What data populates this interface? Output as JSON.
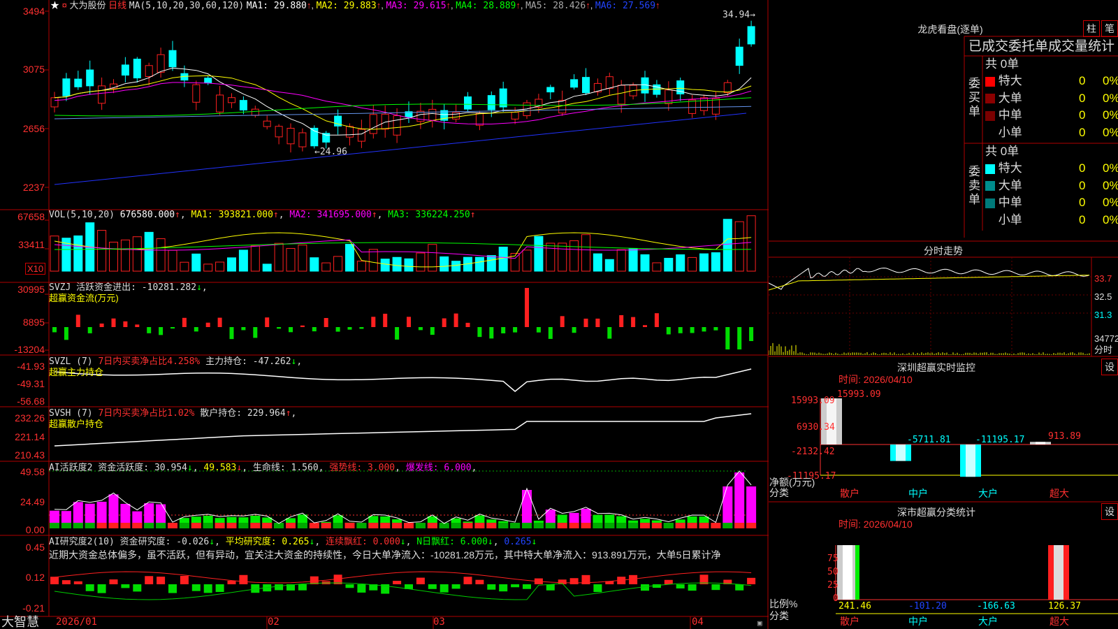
{
  "colors": {
    "up": "#ff2020",
    "down": "#00ffff",
    "ma1": "#ffffff",
    "ma2": "#ffff00",
    "ma3": "#ff00ff",
    "ma4": "#00ff00",
    "ma5": "#6495ed",
    "ma6": "#2222ff",
    "grid": "#aa0000",
    "yellow": "#ffff00",
    "green": "#00ff00",
    "magenta": "#ff00ff"
  },
  "brand": "大智慧",
  "k": {
    "header_prefix": "大为股份",
    "period": "日线",
    "ma_params": "MA(5,10,20,30,60,120)",
    "ma_labels": [
      "MA1: 29.880",
      "MA2: 29.883",
      "MA3: 29.615",
      "MA4: 28.889",
      "MA5: 28.426",
      "MA6: 27.569"
    ],
    "y_labels": [
      "3494",
      "3075",
      "2656",
      "2237"
    ],
    "high_label": "34.94",
    "low_label": "24.96"
  },
  "vol": {
    "header": "VOL(5,10,20)",
    "value": "676580.000",
    "ma_labels": [
      "MA1: 393821.000",
      "MA2: 341695.000",
      "MA3: 336224.250"
    ],
    "y_labels": [
      "67658",
      "33411"
    ],
    "unit": "X10"
  },
  "svzj": {
    "header": "SVZJ  活跃资金进出: -10281.282",
    "subtitle": "超赢资金流(万元)",
    "y_labels": [
      "30995",
      "8895",
      "-13204"
    ]
  },
  "svzl": {
    "header": "SVZL (7)",
    "pct": "7日内买卖净占比4.258%",
    "hold": "主力持仓: -47.262",
    "subtitle": "超赢主力持仓",
    "y_labels": [
      "-41.93",
      "-49.31",
      "-56.68"
    ]
  },
  "svsh": {
    "header": "SVSH (7)",
    "pct": "7日内买卖净占比1.02%",
    "hold": "散户持仓: 229.964",
    "subtitle": "超赢散户持仓",
    "y_labels": [
      "232.26",
      "221.14",
      "210.43"
    ]
  },
  "aihy": {
    "header": "AI活跃度2 资金活跃度: 30.954",
    "v2": "49.583",
    "v3": "生命线: 1.560",
    "v4": "强势线: 3.000",
    "v5": "爆发线: 6.000",
    "y_labels": [
      "49.58",
      "24.49",
      "0.00"
    ]
  },
  "aiyj": {
    "header": "AI研究度2(10) 资金研究度: -0.026",
    "v2": "平均研究度: 0.265",
    "v3": "连续飘红: 0.000",
    "v4": "N日飘红: 6.000",
    "v5": "0.265",
    "comment": "近期大资金总体偏多，虽不活跃，但有异动，宜关注大资金的持续性，今日大单净流入：-10281.28万元，其中特大单净流入：913.891万元，大单5日累计净",
    "y_labels": [
      "0.45",
      "0.12",
      "-0.21"
    ]
  },
  "x_labels": [
    "2026/01",
    "02",
    "03",
    "04"
  ],
  "lhb": {
    "title": "龙虎看盘(逐单)",
    "btn1": "柱",
    "btn2": "笔",
    "tabs": "已成交委托单成交量统计",
    "buy_label": "委买单",
    "sell_label": "委卖单",
    "buy_total": "共 0单",
    "sell_total": "共 0单",
    "buy_rows": [
      {
        "name": "特大",
        "n": "0",
        "pct": "0%",
        "color": "#ff0000"
      },
      {
        "name": "大单",
        "n": "0",
        "pct": "0%",
        "color": "#8b0000"
      },
      {
        "name": "中单",
        "n": "0",
        "pct": "0%",
        "color": "#7a0000"
      },
      {
        "name": "小单",
        "n": "0",
        "pct": "0%",
        "color": "#000000"
      }
    ],
    "sell_rows": [
      {
        "name": "特大",
        "n": "0",
        "pct": "0%",
        "color": "#00ffff"
      },
      {
        "name": "大单",
        "n": "0",
        "pct": "0%",
        "color": "#008b8b"
      },
      {
        "name": "中单",
        "n": "0",
        "pct": "0%",
        "color": "#007a7a"
      },
      {
        "name": "小单",
        "n": "0",
        "pct": "0%",
        "color": "#000000"
      }
    ]
  },
  "fs": {
    "title": "分时走势",
    "y_labels": [
      "33.7",
      "32.5",
      "31.3"
    ],
    "vol_label": "34772",
    "x_label": "分时"
  },
  "szcy": {
    "title": "深圳超赢实时监控",
    "btn": "设",
    "time": "时间: 2026/04/10",
    "y_labels": [
      "15993.09",
      "6930.34",
      "-2132.42",
      "-11195.17"
    ],
    "y_unit": "净额(万元)",
    "x_unit": "分类",
    "cats": [
      "散户",
      "中户",
      "大户",
      "超大"
    ],
    "values": [
      15993.09,
      -5711.81,
      -11195.17,
      913.89
    ],
    "value_labels": [
      "15993.09",
      "-5711.81",
      "-11195.17",
      "913.89"
    ]
  },
  "scfl": {
    "title": "深市超赢分类统计",
    "btn": "设",
    "time": "时间: 2026/04/10",
    "y_labels": [
      "75",
      "50",
      "25",
      "0"
    ],
    "y_unit": "比例%",
    "x_unit": "分类",
    "cats": [
      "散户",
      "中户",
      "大户",
      "超大"
    ],
    "value_labels": [
      "241.46",
      "-101.20",
      "-166.63",
      "126.37"
    ]
  }
}
